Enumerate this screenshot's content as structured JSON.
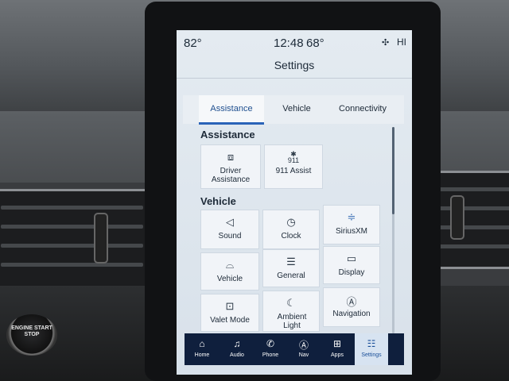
{
  "status_bar": {
    "outside_temp": "82°",
    "time": "12:48",
    "cabin_temp": "68°",
    "fan_icon": "fan-icon",
    "fan_level": "HI"
  },
  "header": {
    "title": "Settings"
  },
  "tabs": [
    {
      "label": "Assistance",
      "active": true
    },
    {
      "label": "Vehicle",
      "active": false
    },
    {
      "label": "Connectivity",
      "active": false
    }
  ],
  "sections": {
    "assistance": {
      "heading": "Assistance",
      "tiles": [
        {
          "label": "Driver Assistance",
          "icon": "driver-assist-icon"
        },
        {
          "label": "911 Assist",
          "icon": "911-icon",
          "icon_text": "911"
        }
      ]
    },
    "vehicle": {
      "heading": "Vehicle",
      "tiles": [
        {
          "label": "Sound",
          "icon": "speaker-icon"
        },
        {
          "label": "Clock",
          "icon": "clock-icon"
        },
        {
          "label": "SiriusXM",
          "icon": "siriusxm-icon"
        },
        {
          "label": "Vehicle",
          "icon": "car-icon"
        },
        {
          "label": "General",
          "icon": "sliders-icon"
        },
        {
          "label": "Display",
          "icon": "display-icon"
        },
        {
          "label": "Valet Mode",
          "icon": "valet-icon"
        },
        {
          "label": "Ambient Light",
          "icon": "ambient-light-icon"
        },
        {
          "label": "Navigation",
          "icon": "navigation-icon"
        }
      ]
    }
  },
  "bottom_nav": [
    {
      "label": "Home",
      "icon": "home-icon"
    },
    {
      "label": "Audio",
      "icon": "music-icon"
    },
    {
      "label": "Phone",
      "icon": "phone-icon"
    },
    {
      "label": "Nav",
      "icon": "compass-icon"
    },
    {
      "label": "Apps",
      "icon": "apps-grid-icon"
    },
    {
      "label": "Settings",
      "icon": "settings-sliders-icon",
      "active": true
    }
  ],
  "car": {
    "start_button_text": "ENGINE START STOP"
  },
  "colors": {
    "accent": "#2a63b8",
    "nav_bar": "#0f1f3d",
    "screen_bg": "#e4ebf1"
  }
}
